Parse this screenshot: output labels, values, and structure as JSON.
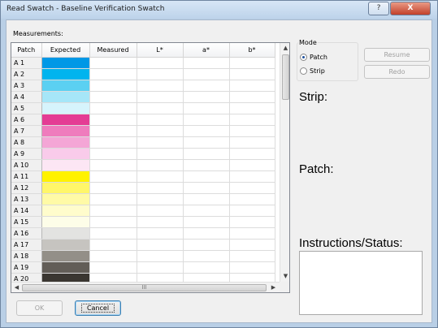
{
  "window": {
    "title": "Read Swatch - Baseline Verification Swatch",
    "help_label": "?",
    "close_label": "X"
  },
  "measurements_label": "Measurements:",
  "table": {
    "columns": [
      "Patch",
      "Expected",
      "Measured",
      "L*",
      "a*",
      "b*"
    ],
    "rows": [
      {
        "patch": "A 1",
        "color": "#0098e6"
      },
      {
        "patch": "A 2",
        "color": "#00b4ee"
      },
      {
        "patch": "A 3",
        "color": "#5bd0f2"
      },
      {
        "patch": "A 4",
        "color": "#a6e6f8"
      },
      {
        "patch": "A 5",
        "color": "#d6f4fc"
      },
      {
        "patch": "A 6",
        "color": "#e43c94"
      },
      {
        "patch": "A 7",
        "color": "#ef7cbd"
      },
      {
        "patch": "A 8",
        "color": "#f4a6d6"
      },
      {
        "patch": "A 9",
        "color": "#f9cbea"
      },
      {
        "patch": "A 10",
        "color": "#fce6f4"
      },
      {
        "patch": "A 11",
        "color": "#fff200"
      },
      {
        "patch": "A 12",
        "color": "#fff66a"
      },
      {
        "patch": "A 13",
        "color": "#fffaa6"
      },
      {
        "patch": "A 14",
        "color": "#fffccc"
      },
      {
        "patch": "A 15",
        "color": "#fdfde8"
      },
      {
        "patch": "A 16",
        "color": "#e3e3e1"
      },
      {
        "patch": "A 17",
        "color": "#c6c4c0"
      },
      {
        "patch": "A 18",
        "color": "#938f88"
      },
      {
        "patch": "A 19",
        "color": "#625d57"
      },
      {
        "patch": "A 20",
        "color": "#3a3631"
      }
    ]
  },
  "mode": {
    "title": "Mode",
    "options": [
      {
        "label": "Patch",
        "selected": true
      },
      {
        "label": "Strip",
        "selected": false
      }
    ]
  },
  "buttons": {
    "resume": "Resume",
    "redo": "Redo",
    "ok": "OK",
    "cancel": "Cancel"
  },
  "labels": {
    "strip": "Strip:",
    "patch": "Patch:",
    "instructions": "Instructions/Status:"
  },
  "scrollbar": {
    "up_icon": "▲",
    "down_icon": "▼",
    "left_icon": "◀",
    "right_icon": "▶",
    "grip_icon": "III"
  }
}
